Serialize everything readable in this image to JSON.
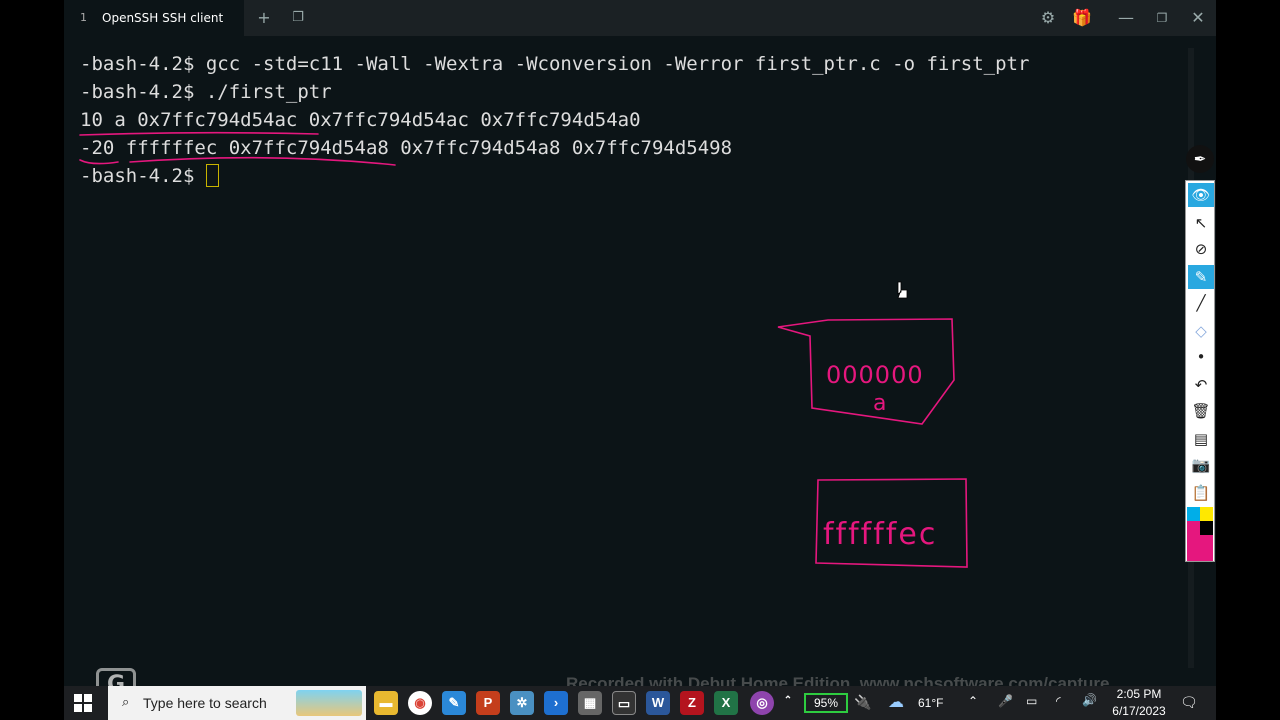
{
  "tab": {
    "index": "1",
    "title": "OpenSSH SSH client"
  },
  "terminal": {
    "lines": [
      "-bash-4.2$ gcc -std=c11 -Wall -Wextra -Wconversion -Werror first_ptr.c -o first_ptr",
      "-bash-4.2$ ./first_ptr",
      "10 a 0x7ffc794d54ac 0x7ffc794d54ac 0x7ffc794d54a0",
      "-20 ffffffec 0x7ffc794d54a8 0x7ffc794d54a8 0x7ffc794d5498",
      "-bash-4.2$ "
    ]
  },
  "drawing": {
    "box1_line1": "000000",
    "box1_line2": "a",
    "box2_text": "ffffffec",
    "ink_color": "#e5177e"
  },
  "watermark": "Recorded with Debut Home Edition. www.nchsoftware.com/capture",
  "taskbar": {
    "search_placeholder": "Type here to search",
    "battery": "95%",
    "weather": "61°F",
    "time": "2:05 PM",
    "date": "6/17/2023"
  }
}
